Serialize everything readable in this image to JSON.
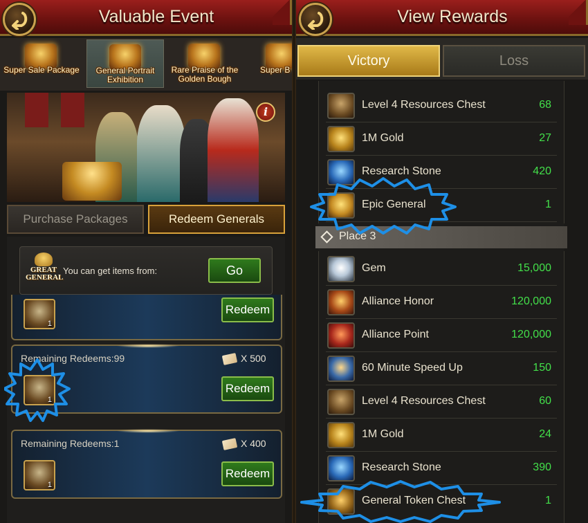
{
  "left": {
    "title": "Valuable Event",
    "event_tabs": [
      {
        "label": "Super Sale Package"
      },
      {
        "label": "General Portrait Exhibition"
      },
      {
        "label": "Rare Praise of the Golden Bough"
      },
      {
        "label": "Super B Sal"
      }
    ],
    "subtabs": {
      "purchase": "Purchase Packages",
      "redeem": "Redeem Generals"
    },
    "info_box": {
      "badge": "GREAT GENERAL",
      "text": "You can get items from:",
      "go_label": "Go"
    },
    "cards": [
      {
        "remaining": "",
        "cost": "",
        "qty": "1",
        "redeem_label": "Redeem"
      },
      {
        "remaining": "Remaining Redeems:99",
        "cost": "X 500",
        "qty": "1",
        "redeem_label": "Redeem"
      },
      {
        "remaining": "Remaining Redeems:1",
        "cost": "X 400",
        "qty": "1",
        "redeem_label": "Redeem"
      }
    ]
  },
  "right": {
    "title": "View Rewards",
    "tabs": {
      "victory": "Victory",
      "loss": "Loss"
    },
    "group_top": [
      {
        "name": "Level 4 Resources Chest",
        "value": "68",
        "icon": "chest-icon"
      },
      {
        "name": "1M Gold",
        "value": "27",
        "icon": "gold-icon"
      },
      {
        "name": "Research Stone",
        "value": "420",
        "icon": "research-stone-icon"
      },
      {
        "name": "Epic General",
        "value": "1",
        "icon": "epic-general-icon"
      }
    ],
    "place_label": "Place 3",
    "group_place3": [
      {
        "name": "Gem",
        "value": "15,000",
        "icon": "gem-icon"
      },
      {
        "name": "Alliance Honor",
        "value": "120,000",
        "icon": "alliance-honor-icon"
      },
      {
        "name": "Alliance Point",
        "value": "120,000",
        "icon": "alliance-point-icon"
      },
      {
        "name": "60 Minute Speed Up",
        "value": "150",
        "icon": "speed-up-icon"
      },
      {
        "name": "Level 4 Resources Chest",
        "value": "60",
        "icon": "chest-icon"
      },
      {
        "name": "1M Gold",
        "value": "24",
        "icon": "gold-icon"
      },
      {
        "name": "Research Stone",
        "value": "390",
        "icon": "research-stone-icon"
      },
      {
        "name": "General Token Chest",
        "value": "1",
        "icon": "token-chest-icon"
      }
    ]
  },
  "colors": {
    "title_red": "#7a1614",
    "gold_border": "#c9a24e",
    "value_green": "#43e04a",
    "highlight_blue": "#1e8fe6",
    "button_green": "#2f7a1c"
  }
}
